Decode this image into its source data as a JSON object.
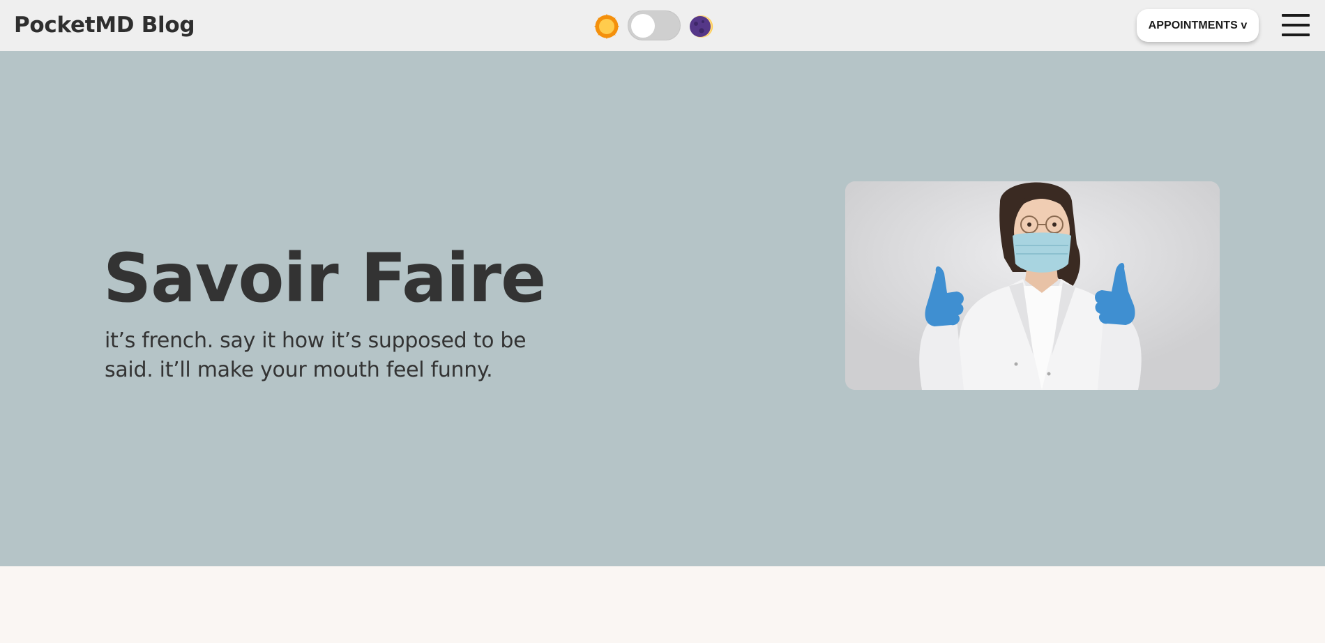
{
  "header": {
    "brand": "PocketMD Blog",
    "theme_toggle": {
      "light_icon": "sun-icon",
      "dark_icon": "moon-icon",
      "state": "light"
    },
    "appointments_label": "APPOINTMENTS v",
    "menu_icon": "hamburger-menu-icon"
  },
  "hero": {
    "title": "Savoir Faire",
    "subtitle": "it’s french. say it how it’s supposed to be said. it’ll make your mouth feel funny.",
    "image": "doctor-thumbs-up-photo"
  },
  "colors": {
    "header_bg": "#efefef",
    "hero_bg": "#b5c4c7",
    "page_bg": "#faf6f3",
    "text": "#333333"
  }
}
